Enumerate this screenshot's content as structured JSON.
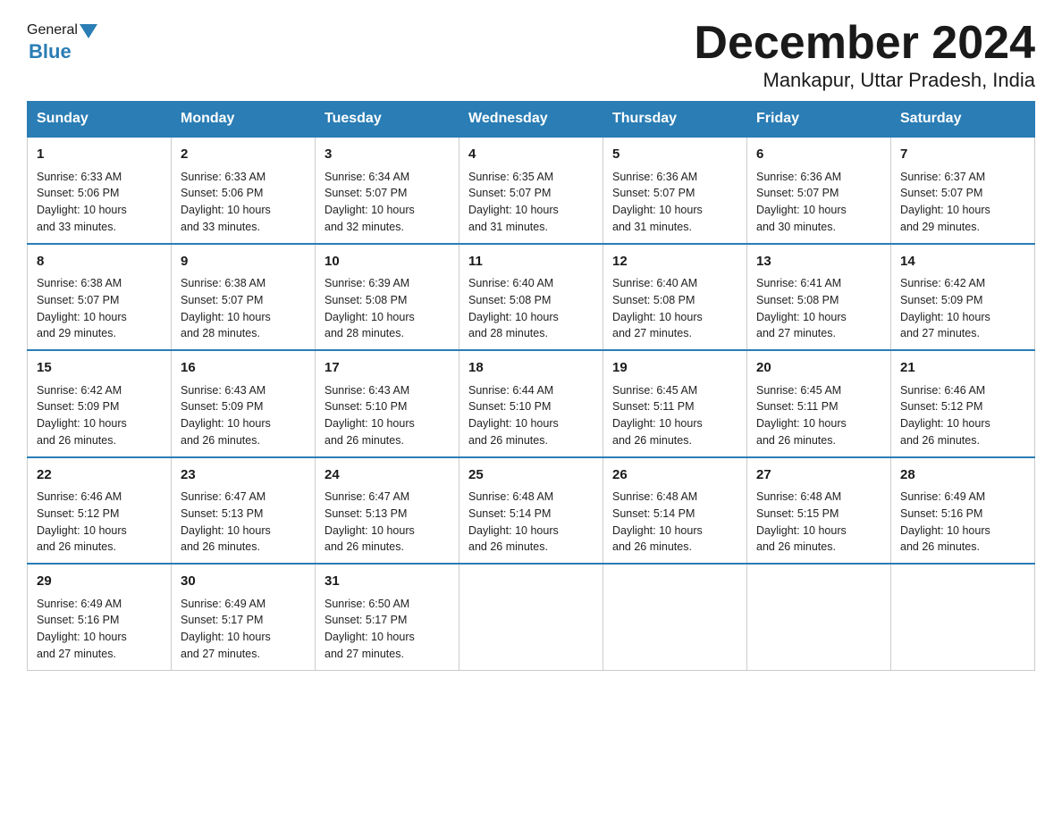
{
  "header": {
    "logo_general": "General",
    "logo_blue": "Blue",
    "month_title": "December 2024",
    "location": "Mankapur, Uttar Pradesh, India"
  },
  "days_of_week": [
    "Sunday",
    "Monday",
    "Tuesday",
    "Wednesday",
    "Thursday",
    "Friday",
    "Saturday"
  ],
  "weeks": [
    [
      {
        "day": 1,
        "sunrise": "6:33 AM",
        "sunset": "5:06 PM",
        "daylight": "10 hours and 33 minutes."
      },
      {
        "day": 2,
        "sunrise": "6:33 AM",
        "sunset": "5:06 PM",
        "daylight": "10 hours and 33 minutes."
      },
      {
        "day": 3,
        "sunrise": "6:34 AM",
        "sunset": "5:07 PM",
        "daylight": "10 hours and 32 minutes."
      },
      {
        "day": 4,
        "sunrise": "6:35 AM",
        "sunset": "5:07 PM",
        "daylight": "10 hours and 31 minutes."
      },
      {
        "day": 5,
        "sunrise": "6:36 AM",
        "sunset": "5:07 PM",
        "daylight": "10 hours and 31 minutes."
      },
      {
        "day": 6,
        "sunrise": "6:36 AM",
        "sunset": "5:07 PM",
        "daylight": "10 hours and 30 minutes."
      },
      {
        "day": 7,
        "sunrise": "6:37 AM",
        "sunset": "5:07 PM",
        "daylight": "10 hours and 29 minutes."
      }
    ],
    [
      {
        "day": 8,
        "sunrise": "6:38 AM",
        "sunset": "5:07 PM",
        "daylight": "10 hours and 29 minutes."
      },
      {
        "day": 9,
        "sunrise": "6:38 AM",
        "sunset": "5:07 PM",
        "daylight": "10 hours and 28 minutes."
      },
      {
        "day": 10,
        "sunrise": "6:39 AM",
        "sunset": "5:08 PM",
        "daylight": "10 hours and 28 minutes."
      },
      {
        "day": 11,
        "sunrise": "6:40 AM",
        "sunset": "5:08 PM",
        "daylight": "10 hours and 28 minutes."
      },
      {
        "day": 12,
        "sunrise": "6:40 AM",
        "sunset": "5:08 PM",
        "daylight": "10 hours and 27 minutes."
      },
      {
        "day": 13,
        "sunrise": "6:41 AM",
        "sunset": "5:08 PM",
        "daylight": "10 hours and 27 minutes."
      },
      {
        "day": 14,
        "sunrise": "6:42 AM",
        "sunset": "5:09 PM",
        "daylight": "10 hours and 27 minutes."
      }
    ],
    [
      {
        "day": 15,
        "sunrise": "6:42 AM",
        "sunset": "5:09 PM",
        "daylight": "10 hours and 26 minutes."
      },
      {
        "day": 16,
        "sunrise": "6:43 AM",
        "sunset": "5:09 PM",
        "daylight": "10 hours and 26 minutes."
      },
      {
        "day": 17,
        "sunrise": "6:43 AM",
        "sunset": "5:10 PM",
        "daylight": "10 hours and 26 minutes."
      },
      {
        "day": 18,
        "sunrise": "6:44 AM",
        "sunset": "5:10 PM",
        "daylight": "10 hours and 26 minutes."
      },
      {
        "day": 19,
        "sunrise": "6:45 AM",
        "sunset": "5:11 PM",
        "daylight": "10 hours and 26 minutes."
      },
      {
        "day": 20,
        "sunrise": "6:45 AM",
        "sunset": "5:11 PM",
        "daylight": "10 hours and 26 minutes."
      },
      {
        "day": 21,
        "sunrise": "6:46 AM",
        "sunset": "5:12 PM",
        "daylight": "10 hours and 26 minutes."
      }
    ],
    [
      {
        "day": 22,
        "sunrise": "6:46 AM",
        "sunset": "5:12 PM",
        "daylight": "10 hours and 26 minutes."
      },
      {
        "day": 23,
        "sunrise": "6:47 AM",
        "sunset": "5:13 PM",
        "daylight": "10 hours and 26 minutes."
      },
      {
        "day": 24,
        "sunrise": "6:47 AM",
        "sunset": "5:13 PM",
        "daylight": "10 hours and 26 minutes."
      },
      {
        "day": 25,
        "sunrise": "6:48 AM",
        "sunset": "5:14 PM",
        "daylight": "10 hours and 26 minutes."
      },
      {
        "day": 26,
        "sunrise": "6:48 AM",
        "sunset": "5:14 PM",
        "daylight": "10 hours and 26 minutes."
      },
      {
        "day": 27,
        "sunrise": "6:48 AM",
        "sunset": "5:15 PM",
        "daylight": "10 hours and 26 minutes."
      },
      {
        "day": 28,
        "sunrise": "6:49 AM",
        "sunset": "5:16 PM",
        "daylight": "10 hours and 26 minutes."
      }
    ],
    [
      {
        "day": 29,
        "sunrise": "6:49 AM",
        "sunset": "5:16 PM",
        "daylight": "10 hours and 27 minutes."
      },
      {
        "day": 30,
        "sunrise": "6:49 AM",
        "sunset": "5:17 PM",
        "daylight": "10 hours and 27 minutes."
      },
      {
        "day": 31,
        "sunrise": "6:50 AM",
        "sunset": "5:17 PM",
        "daylight": "10 hours and 27 minutes."
      },
      null,
      null,
      null,
      null
    ]
  ],
  "labels": {
    "sunrise": "Sunrise:",
    "sunset": "Sunset:",
    "daylight": "Daylight:"
  }
}
